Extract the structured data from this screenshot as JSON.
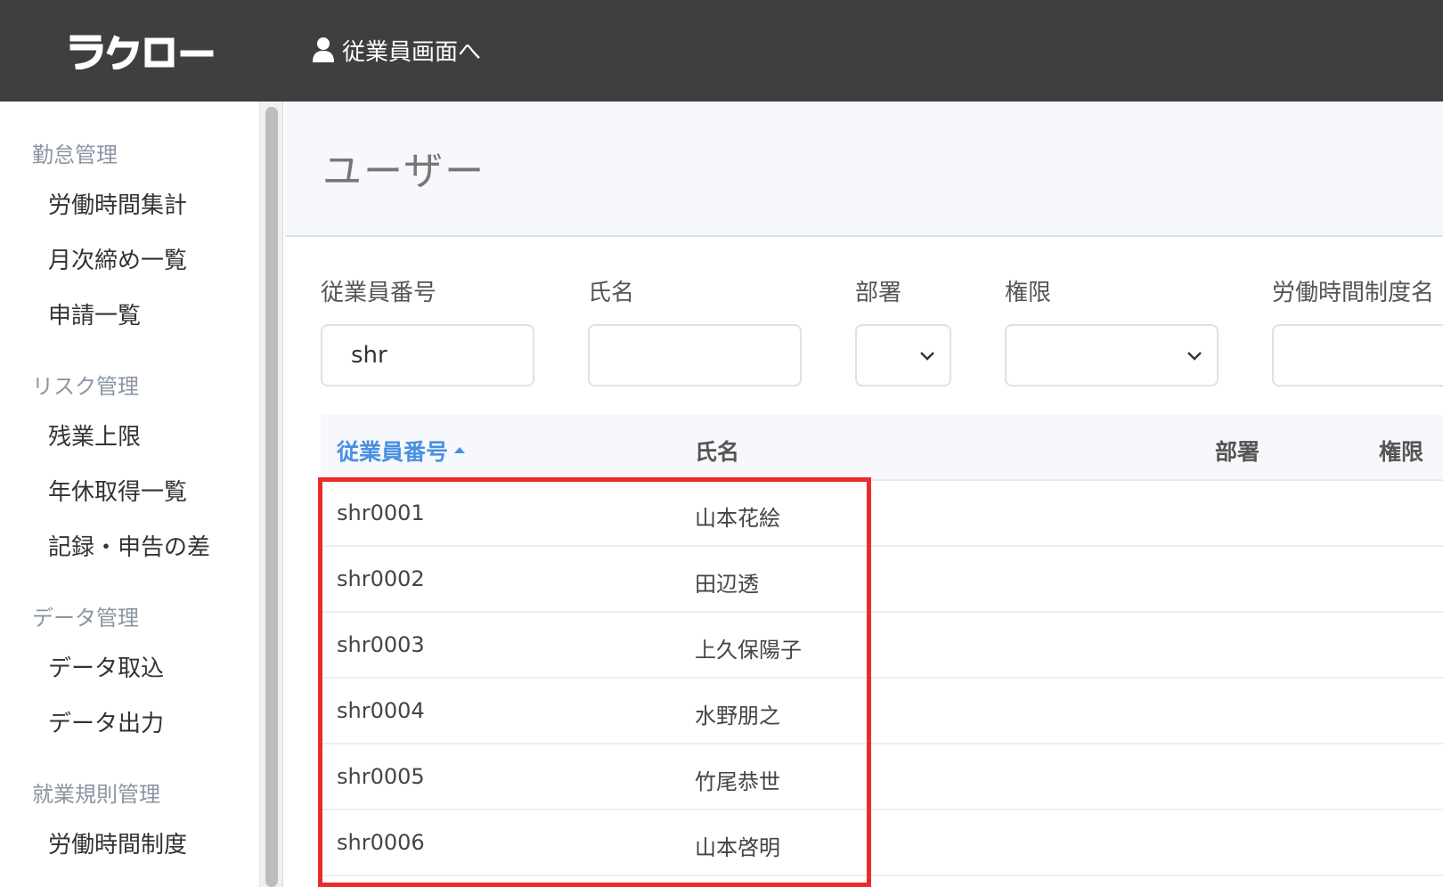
{
  "header": {
    "logo_text": "ラクロー",
    "employee_link": "従業員画面へ"
  },
  "sidebar": {
    "groups": [
      {
        "label": "勤怠管理",
        "items": [
          "労働時間集計",
          "月次締め一覧",
          "申請一覧"
        ]
      },
      {
        "label": "リスク管理",
        "items": [
          "残業上限",
          "年休取得一覧",
          "記録・申告の差"
        ]
      },
      {
        "label": "データ管理",
        "items": [
          "データ取込",
          "データ出力"
        ]
      },
      {
        "label": "就業規則管理",
        "items": [
          "労働時間制度"
        ]
      }
    ]
  },
  "page": {
    "title": "ユーザー"
  },
  "filters": {
    "employee_number": {
      "label": "従業員番号",
      "value": "shr"
    },
    "name": {
      "label": "氏名",
      "value": ""
    },
    "department": {
      "label": "部署",
      "value": ""
    },
    "permission": {
      "label": "権限",
      "value": ""
    },
    "work_system": {
      "label": "労働時間制度名",
      "value": ""
    }
  },
  "table": {
    "columns": [
      "従業員番号",
      "氏名",
      "部署",
      "権限"
    ],
    "sorted_column": "従業員番号",
    "sort_direction": "asc",
    "rows": [
      {
        "employee_number": "shr0001",
        "name": "山本花絵"
      },
      {
        "employee_number": "shr0002",
        "name": "田辺透"
      },
      {
        "employee_number": "shr0003",
        "name": "上久保陽子"
      },
      {
        "employee_number": "shr0004",
        "name": "水野朋之"
      },
      {
        "employee_number": "shr0005",
        "name": "竹尾恭世"
      },
      {
        "employee_number": "shr0006",
        "name": "山本啓明"
      }
    ]
  },
  "colors": {
    "topbar": "#3f3f3f",
    "accent": "#4a90e2",
    "highlight": "#ec2b2b"
  }
}
